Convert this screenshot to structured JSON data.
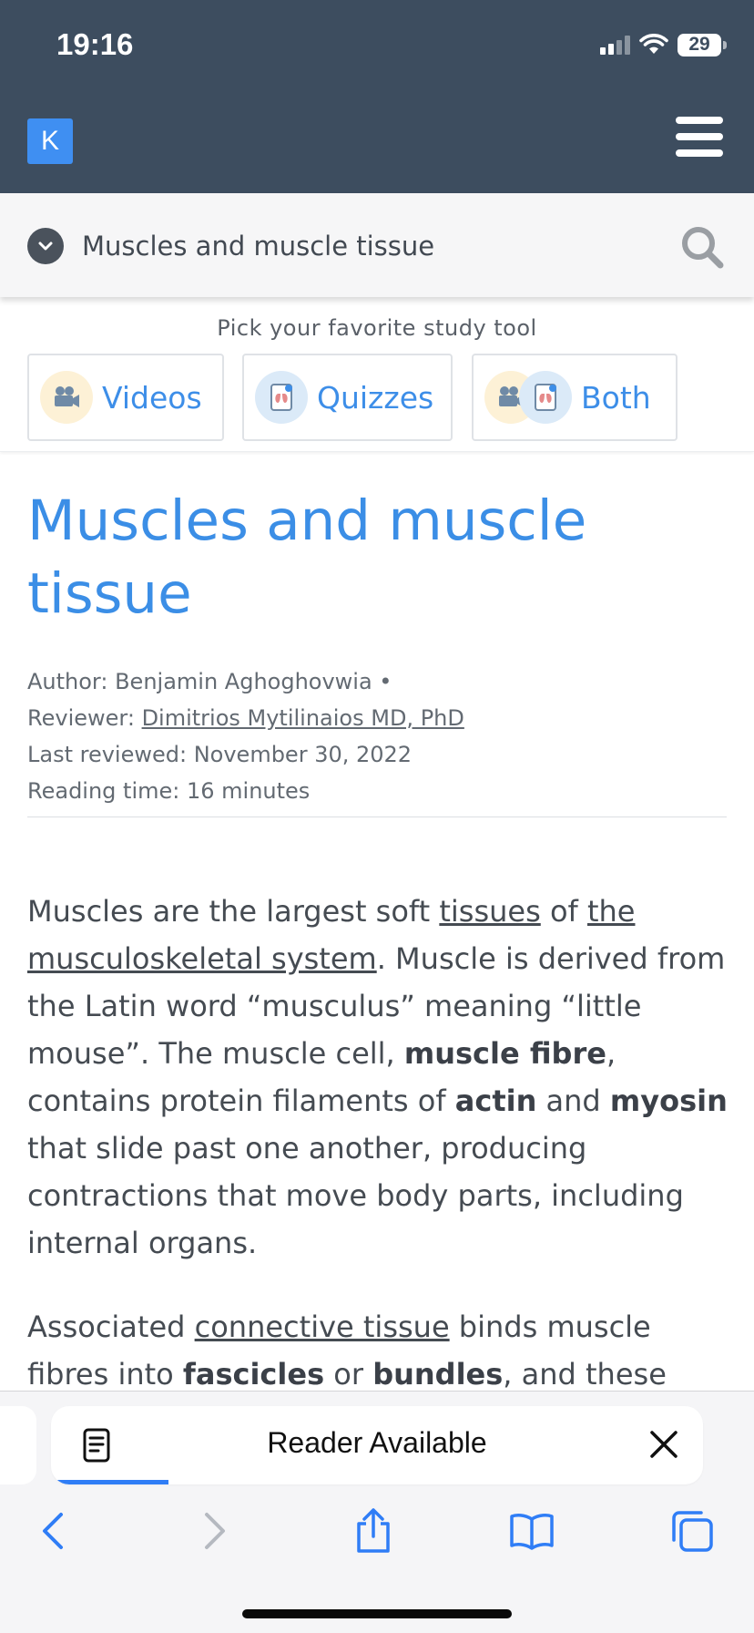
{
  "status_bar": {
    "time": "19:16",
    "battery": "29"
  },
  "header": {
    "logo": "K"
  },
  "topic_bar": {
    "title": "Muscles and muscle tissue"
  },
  "study_tool": {
    "label": "Pick your favorite study tool",
    "options": [
      "Videos",
      "Quizzes",
      "Both"
    ]
  },
  "article": {
    "title": "Muscles and muscle tissue",
    "meta": {
      "author_label": "Author: Benjamin Aghoghovwia •",
      "reviewer_prefix": "Reviewer: ",
      "reviewer_name": "Dimitrios Mytilinaios MD, PhD",
      "last_reviewed": "Last reviewed: November 30, 2022",
      "reading_time": "Reading time: 16 minutes"
    },
    "p1": {
      "t1": "Muscles are the largest soft ",
      "link1": "tissues",
      "t2": " of ",
      "link2": "the musculoskeletal system",
      "t3": ". Muscle is derived from the Latin word “musculus” meaning “little mouse”. The muscle cell, ",
      "b1": "muscle fibre",
      "t4": ", contains protein filaments of ",
      "b2": "actin",
      "t5": " and ",
      "b3": "myosin",
      "t6": " that slide past one another, producing contractions that move body parts, including internal organs."
    },
    "p2": {
      "t1": "Associated ",
      "link1": "connective tissue",
      "t2": " binds muscle fibres into ",
      "b1": "fascicles",
      "t3": " or ",
      "b2": "bundles",
      "t4": ", and these"
    }
  },
  "reader_bar": {
    "label": "Reader Available",
    "progress": 0.18
  },
  "toolbar": {
    "icons": [
      "back-icon",
      "forward-icon",
      "share-icon",
      "bookmarks-icon",
      "tabs-icon"
    ]
  },
  "colors": {
    "header_bg": "#3d4d5f",
    "accent": "#3b8ee6",
    "logo_bg": "#3f8ff2"
  }
}
